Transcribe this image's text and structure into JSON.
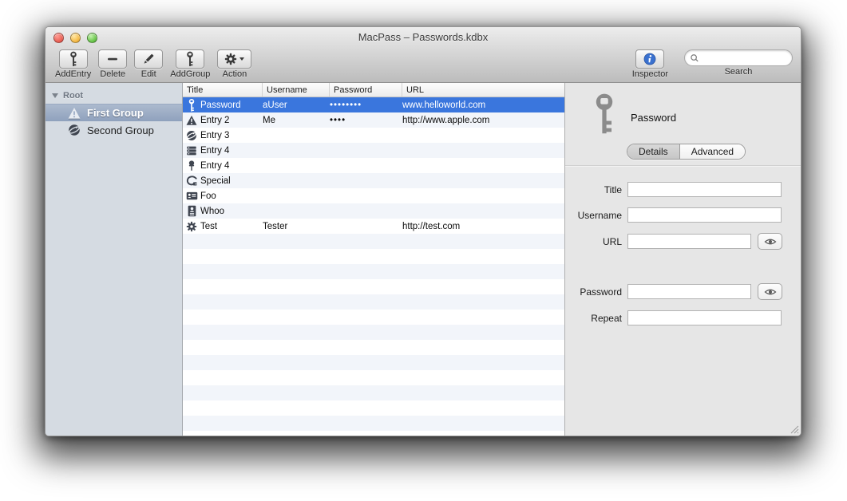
{
  "window": {
    "title": "MacPass – Passwords.kdbx"
  },
  "toolbar": {
    "buttons": [
      {
        "label": "AddEntry",
        "icon": "key-icon"
      },
      {
        "label": "Delete",
        "icon": "minus-icon"
      },
      {
        "label": "Edit",
        "icon": "pencil-icon"
      },
      {
        "label": "AddGroup",
        "icon": "key-icon"
      },
      {
        "label": "Action",
        "icon": "gear-icon"
      }
    ],
    "inspector_label": "Inspector",
    "search_label": "Search",
    "search_placeholder": ""
  },
  "sidebar": {
    "root_label": "Root",
    "groups": [
      {
        "label": "First Group",
        "icon": "warning-icon",
        "selected": true
      },
      {
        "label": "Second Group",
        "icon": "globe-icon",
        "selected": false
      }
    ]
  },
  "table": {
    "columns": [
      "Title",
      "Username",
      "Password",
      "URL"
    ],
    "rows": [
      {
        "icon": "key-icon",
        "title": "Password",
        "username": "aUser",
        "password": "••••••••",
        "url": "www.helloworld.com",
        "selected": true
      },
      {
        "icon": "warning-icon",
        "title": "Entry 2",
        "username": "Me",
        "password": "••••",
        "url": "http://www.apple.com",
        "selected": false
      },
      {
        "icon": "globe-icon",
        "title": "Entry 3",
        "username": "",
        "password": "",
        "url": "",
        "selected": false
      },
      {
        "icon": "server-icon",
        "title": "Entry 4",
        "username": "",
        "password": "",
        "url": "",
        "selected": false
      },
      {
        "icon": "pin-icon",
        "title": "Entry 4",
        "username": "",
        "password": "",
        "url": "",
        "selected": false
      },
      {
        "icon": "plug-icon",
        "title": "Special",
        "username": "",
        "password": "",
        "url": "",
        "selected": false
      },
      {
        "icon": "idcard-icon",
        "title": "Foo",
        "username": "",
        "password": "",
        "url": "",
        "selected": false
      },
      {
        "icon": "contact-icon",
        "title": "Whoo",
        "username": "",
        "password": "",
        "url": "",
        "selected": false
      },
      {
        "icon": "gear-icon",
        "title": "Test",
        "username": "Tester",
        "password": "",
        "url": "http://test.com",
        "selected": false
      }
    ]
  },
  "inspector": {
    "entry_title": "Password",
    "entry_icon": "key-icon",
    "tabs": [
      {
        "label": "Details",
        "selected": true
      },
      {
        "label": "Advanced",
        "selected": false
      }
    ],
    "fields": {
      "title": {
        "label": "Title",
        "value": ""
      },
      "username": {
        "label": "Username",
        "value": ""
      },
      "url": {
        "label": "URL",
        "value": "",
        "has_eye": true
      },
      "password": {
        "label": "Password",
        "value": "",
        "has_eye": true
      },
      "repeat": {
        "label": "Repeat",
        "value": ""
      }
    }
  },
  "colors": {
    "selection_blue": "#3a76dd",
    "row_stripe": "#f2f5fa",
    "sidebar_bg": "#d5dbe2",
    "sidebar_selection": "#8fa1bd",
    "inspector_bg": "#e6e6e6",
    "chrome_top": "#ededed",
    "chrome_bottom": "#bcbcbc"
  }
}
